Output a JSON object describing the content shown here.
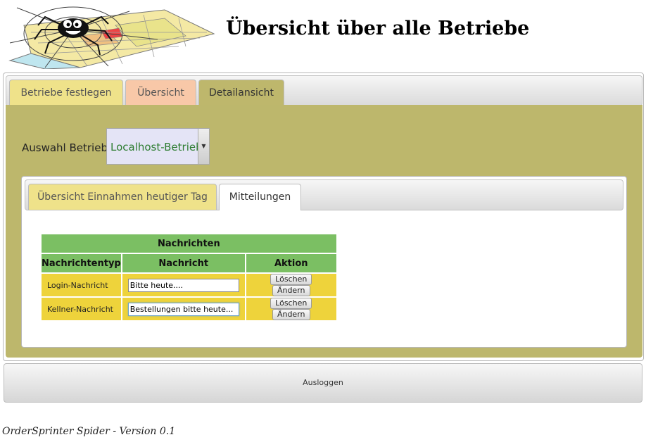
{
  "header": {
    "title": "Übersicht über alle Betriebe",
    "logo_icon": "spider-web-logo-icon"
  },
  "outer_tabs": [
    {
      "label": "Betriebe festlegen"
    },
    {
      "label": "Übersicht"
    },
    {
      "label": "Detailansicht",
      "active": true
    }
  ],
  "selection": {
    "label": "Auswahl Betrieb:",
    "value": "Localhost-Betrieb"
  },
  "inner_tabs": [
    {
      "label": "Übersicht Einnahmen heutiger Tag"
    },
    {
      "label": "Mitteilungen",
      "active": true
    }
  ],
  "messages_table": {
    "caption": "Nachrichten",
    "headers": [
      "Nachrichtentyp",
      "Nachricht",
      "Aktion"
    ],
    "rows": [
      {
        "type": "Login-Nachricht",
        "message": "Bitte heute....",
        "delete_label": "Löschen",
        "edit_label": "Ändern"
      },
      {
        "type": "Kellner-Nachricht",
        "message": "Bestellungen bitte heute...",
        "delete_label": "Löschen",
        "edit_label": "Ändern"
      }
    ]
  },
  "logout_label": "Ausloggen",
  "footer": "OrderSprinter Spider - Version 0.1",
  "colors": {
    "content_bg": "#bdb76c",
    "tab_yellow": "#efe28a",
    "tab_peach": "#f8c8a8",
    "table_header_green": "#7bbf63",
    "table_cell_yellow": "#eed33b"
  }
}
